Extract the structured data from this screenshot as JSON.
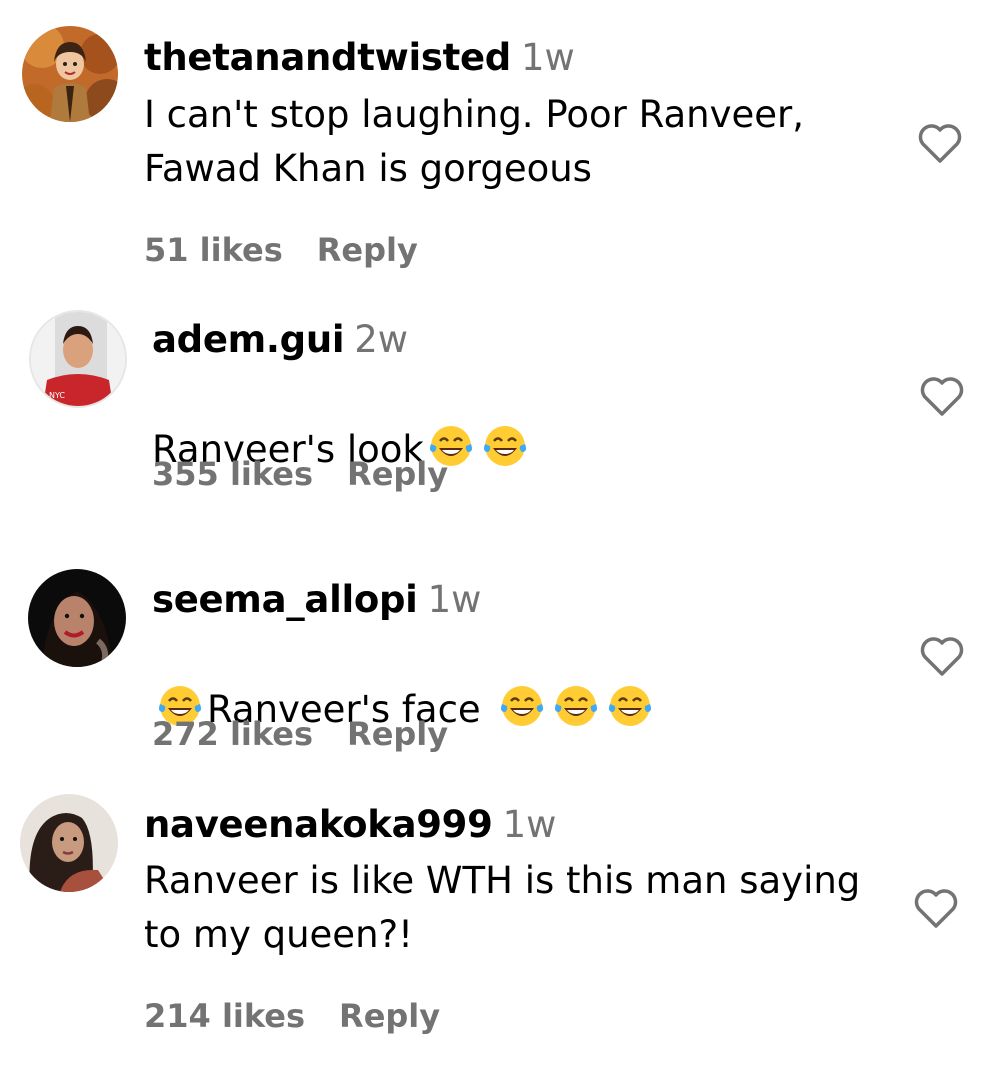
{
  "comments": [
    {
      "username": "thetanandtwisted",
      "time": "1w",
      "text": "I can't stop laughing. Poor Ranveer,\nFawad Khan is gorgeous",
      "likes": "51 likes",
      "reply": "Reply",
      "avatar": "cartoon-avatar-autumn"
    },
    {
      "username": "adem.gui",
      "time": "2w",
      "text_before": "Ranveer's look",
      "emojis": [
        "face-with-tears-of-joy",
        "face-with-tears-of-joy"
      ],
      "likes": "355 likes",
      "reply": "Reply",
      "avatar": "person-red-shirt"
    },
    {
      "username": "seema_allopi",
      "time": "1w",
      "leading_emoji": "face-with-tears-of-joy",
      "text_before": "Ranveer's face",
      "emojis": [
        "face-with-tears-of-joy",
        "face-with-tears-of-joy",
        "face-with-tears-of-joy"
      ],
      "likes": "272 likes",
      "reply": "Reply",
      "avatar": "woman-red-lipstick"
    },
    {
      "username": "naveenakoka999",
      "time": "1w",
      "text": "Ranveer is like WTH is this man saying\nto my queen?!",
      "likes": "214 likes",
      "reply": "Reply",
      "avatar": "woman-long-hair"
    }
  ],
  "icons": {
    "like": "heart-outline-icon"
  },
  "colors": {
    "secondary_text": "#737373",
    "primary_text": "#000000",
    "emoji_face": "#FFCC33",
    "emoji_tear": "#3FA9F5"
  }
}
